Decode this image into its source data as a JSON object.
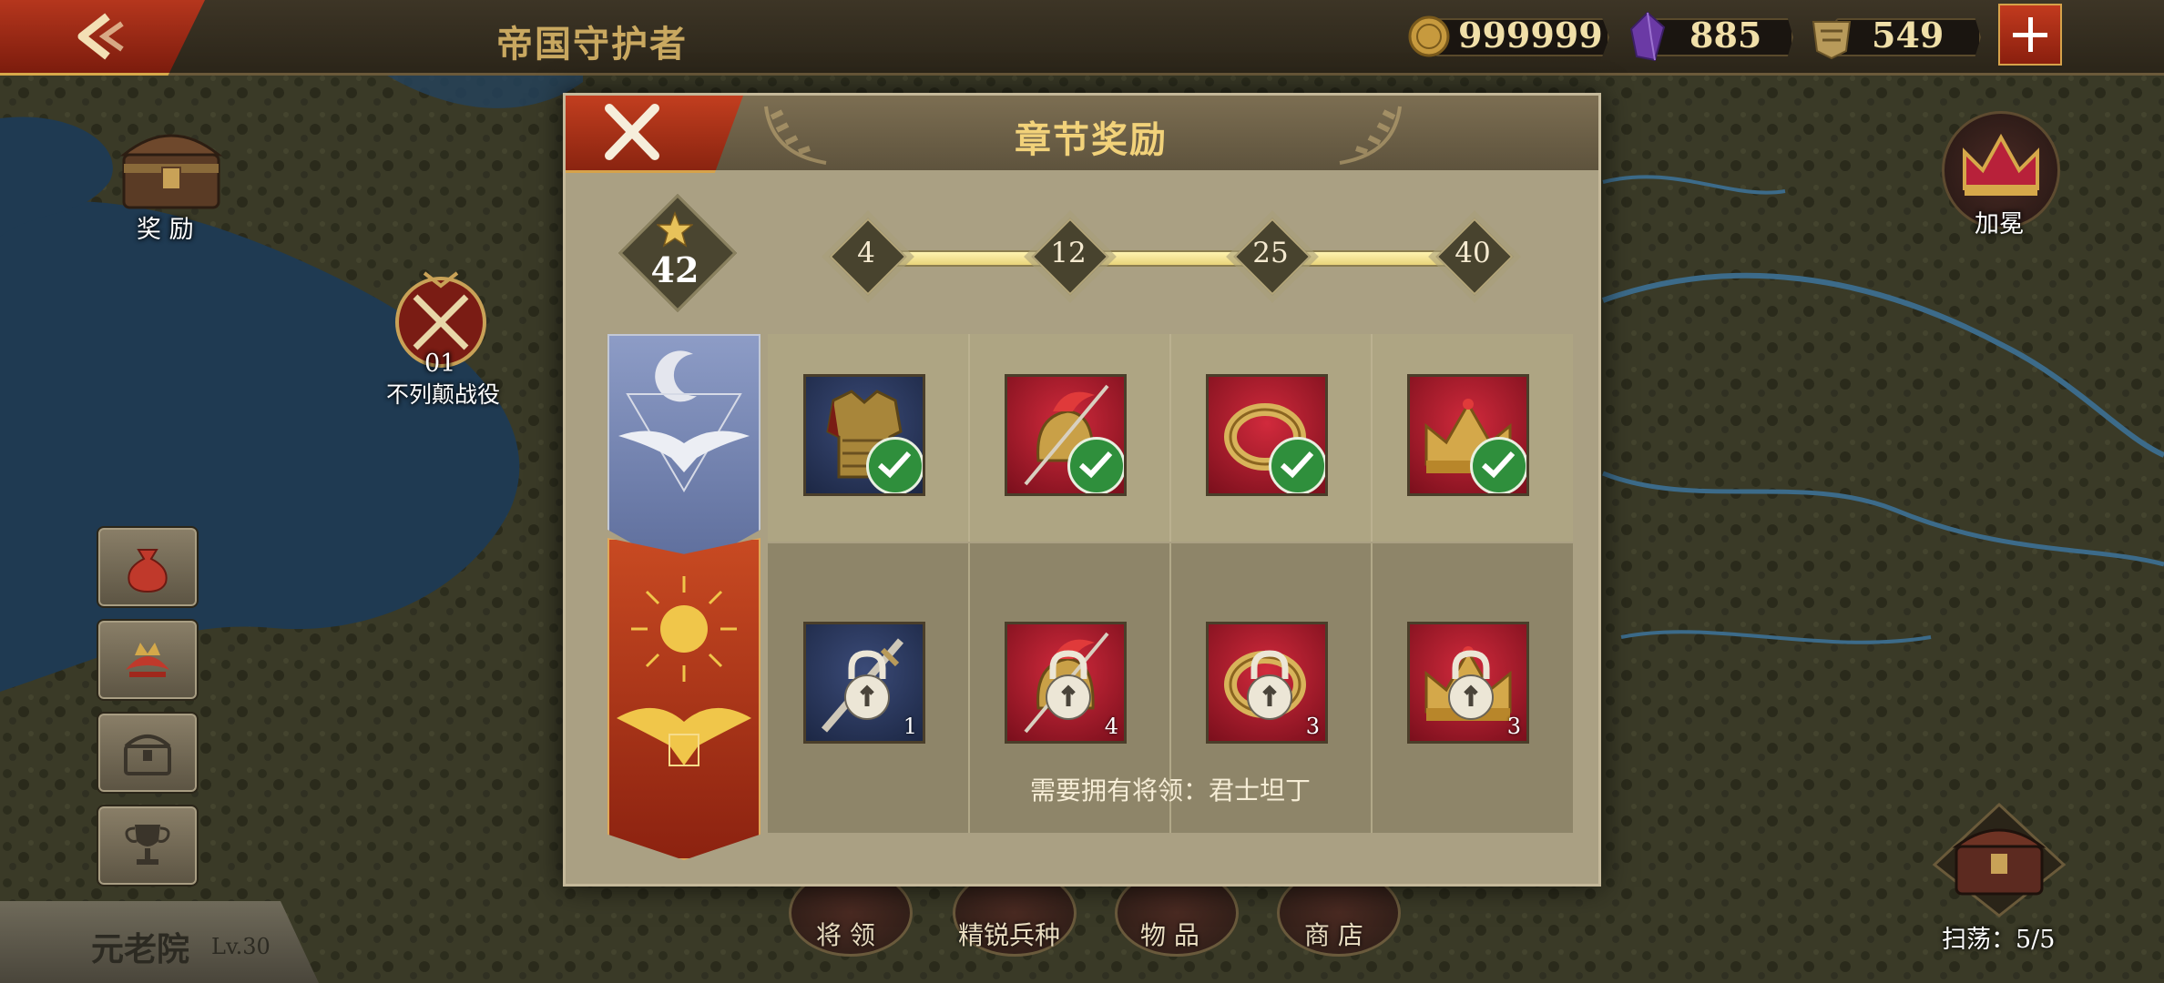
{
  "top_bar": {
    "title": "帝国守护者",
    "resources": {
      "coins": "999999",
      "gems": "885",
      "tokens": "549"
    }
  },
  "map": {
    "rewards_label": "奖  励",
    "battle": {
      "number": "01",
      "name": "不列颠战役"
    },
    "coronation_label": "加冕",
    "senate": {
      "name": "元老院",
      "level": "Lv.30"
    },
    "sweep_label": "扫荡：5/5",
    "bottom_tabs": [
      "将  领",
      "精锐兵种",
      "物  品",
      "商  店"
    ]
  },
  "dialog": {
    "title": "章节奖励",
    "stars": "42",
    "milestones": [
      "4",
      "12",
      "25",
      "40"
    ],
    "free_rewards": [
      {
        "icon": "armor-icon",
        "claimed": true
      },
      {
        "icon": "helmet-icon",
        "claimed": true
      },
      {
        "icon": "ring-icon",
        "claimed": true
      },
      {
        "icon": "crown-icon",
        "claimed": true
      }
    ],
    "premium_rewards": [
      {
        "icon": "sword-icon",
        "qty": "1",
        "locked": true
      },
      {
        "icon": "helmet-icon",
        "qty": "4",
        "locked": true
      },
      {
        "icon": "ring-icon",
        "qty": "3",
        "locked": true
      },
      {
        "icon": "crown-icon",
        "qty": "3",
        "locked": true
      }
    ],
    "requirement": "需要拥有将领：君士坦丁"
  },
  "colors": {
    "accent_red": "#b5361d",
    "gold_text": "#f2d27a",
    "claimed_green": "#2f8f3c",
    "panel": "#aaa083"
  }
}
